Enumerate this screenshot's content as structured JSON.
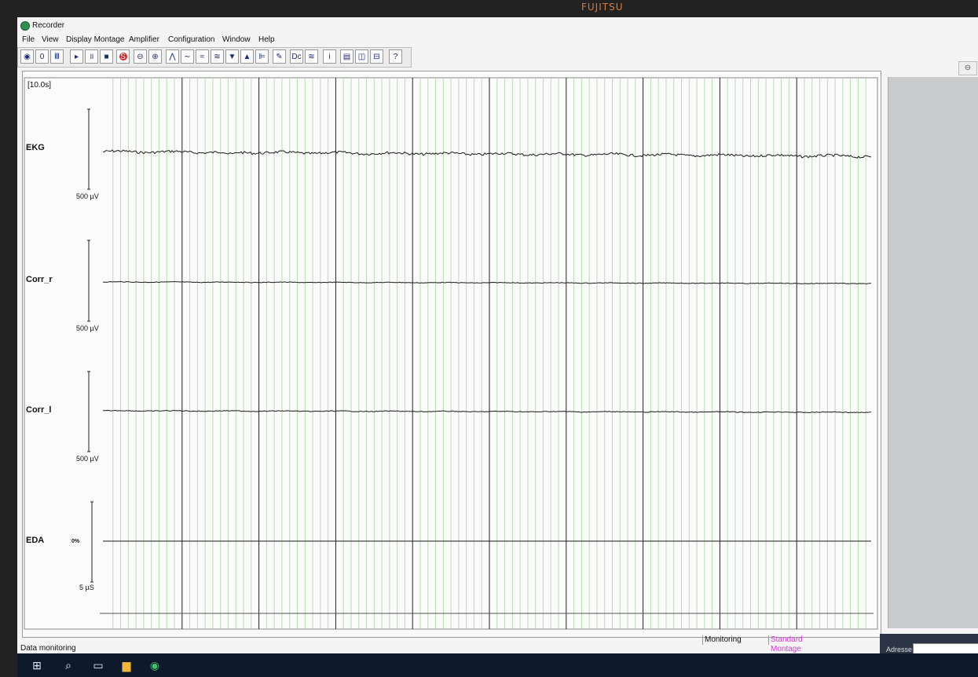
{
  "brand": "FUJITSU",
  "window": {
    "title": "Recorder"
  },
  "menu": [
    "File",
    "View",
    "Display Montage",
    "Amplifier",
    "Configuration",
    "Window",
    "Help"
  ],
  "toolbar": [
    {
      "name": "monitor-eye-icon",
      "glyph": "◉"
    },
    {
      "name": "zero-button",
      "glyph": "0"
    },
    {
      "name": "impedance-button",
      "glyph": "Ⅲ"
    },
    {
      "name": "play-button",
      "glyph": "▸"
    },
    {
      "name": "pause-button",
      "glyph": "॥"
    },
    {
      "name": "stop-button",
      "glyph": "■"
    },
    {
      "name": "record-button",
      "glyph": "S"
    },
    {
      "name": "zoom-out-icon",
      "glyph": "⊖"
    },
    {
      "name": "zoom-in-icon",
      "glyph": "⊕"
    },
    {
      "name": "amplitude-up-icon",
      "glyph": "⋀"
    },
    {
      "name": "amplitude-down-icon",
      "glyph": "∼"
    },
    {
      "name": "filter-icon",
      "glyph": "≈"
    },
    {
      "name": "filter-settings-icon",
      "glyph": "≋"
    },
    {
      "name": "scroll-down-icon",
      "glyph": "▼"
    },
    {
      "name": "scroll-up-icon",
      "glyph": "▲"
    },
    {
      "name": "marker-icon",
      "glyph": "⊫"
    },
    {
      "name": "pen-icon",
      "glyph": "✎"
    },
    {
      "name": "dc-icon",
      "glyph": "Dc"
    },
    {
      "name": "wave-icon",
      "glyph": "≋"
    },
    {
      "name": "info-icon",
      "glyph": "i"
    },
    {
      "name": "print-icon",
      "glyph": "▤"
    },
    {
      "name": "layout-vertical-icon",
      "glyph": "◫"
    },
    {
      "name": "layout-horizontal-icon",
      "glyph": "⊟"
    },
    {
      "name": "help-icon",
      "glyph": "?"
    }
  ],
  "chart": {
    "time_window": "[10.0s]",
    "channels": [
      {
        "label": "EKG",
        "scale": "500 µV",
        "offset": ""
      },
      {
        "label": "Corr_r",
        "scale": "500 µV",
        "offset": ""
      },
      {
        "label": "Corr_l",
        "scale": "500 µV",
        "offset": ""
      },
      {
        "label": "EDA",
        "scale": "5 µS",
        "offset": "0%"
      }
    ]
  },
  "status": {
    "left": "Data monitoring",
    "mode": "Monitoring",
    "montage": "Standard Montage",
    "address_label": "Adresse"
  },
  "colors": {
    "montage": "#d23ad2",
    "grid_minor": "#b8d8b0",
    "grid_major": "#222222"
  }
}
